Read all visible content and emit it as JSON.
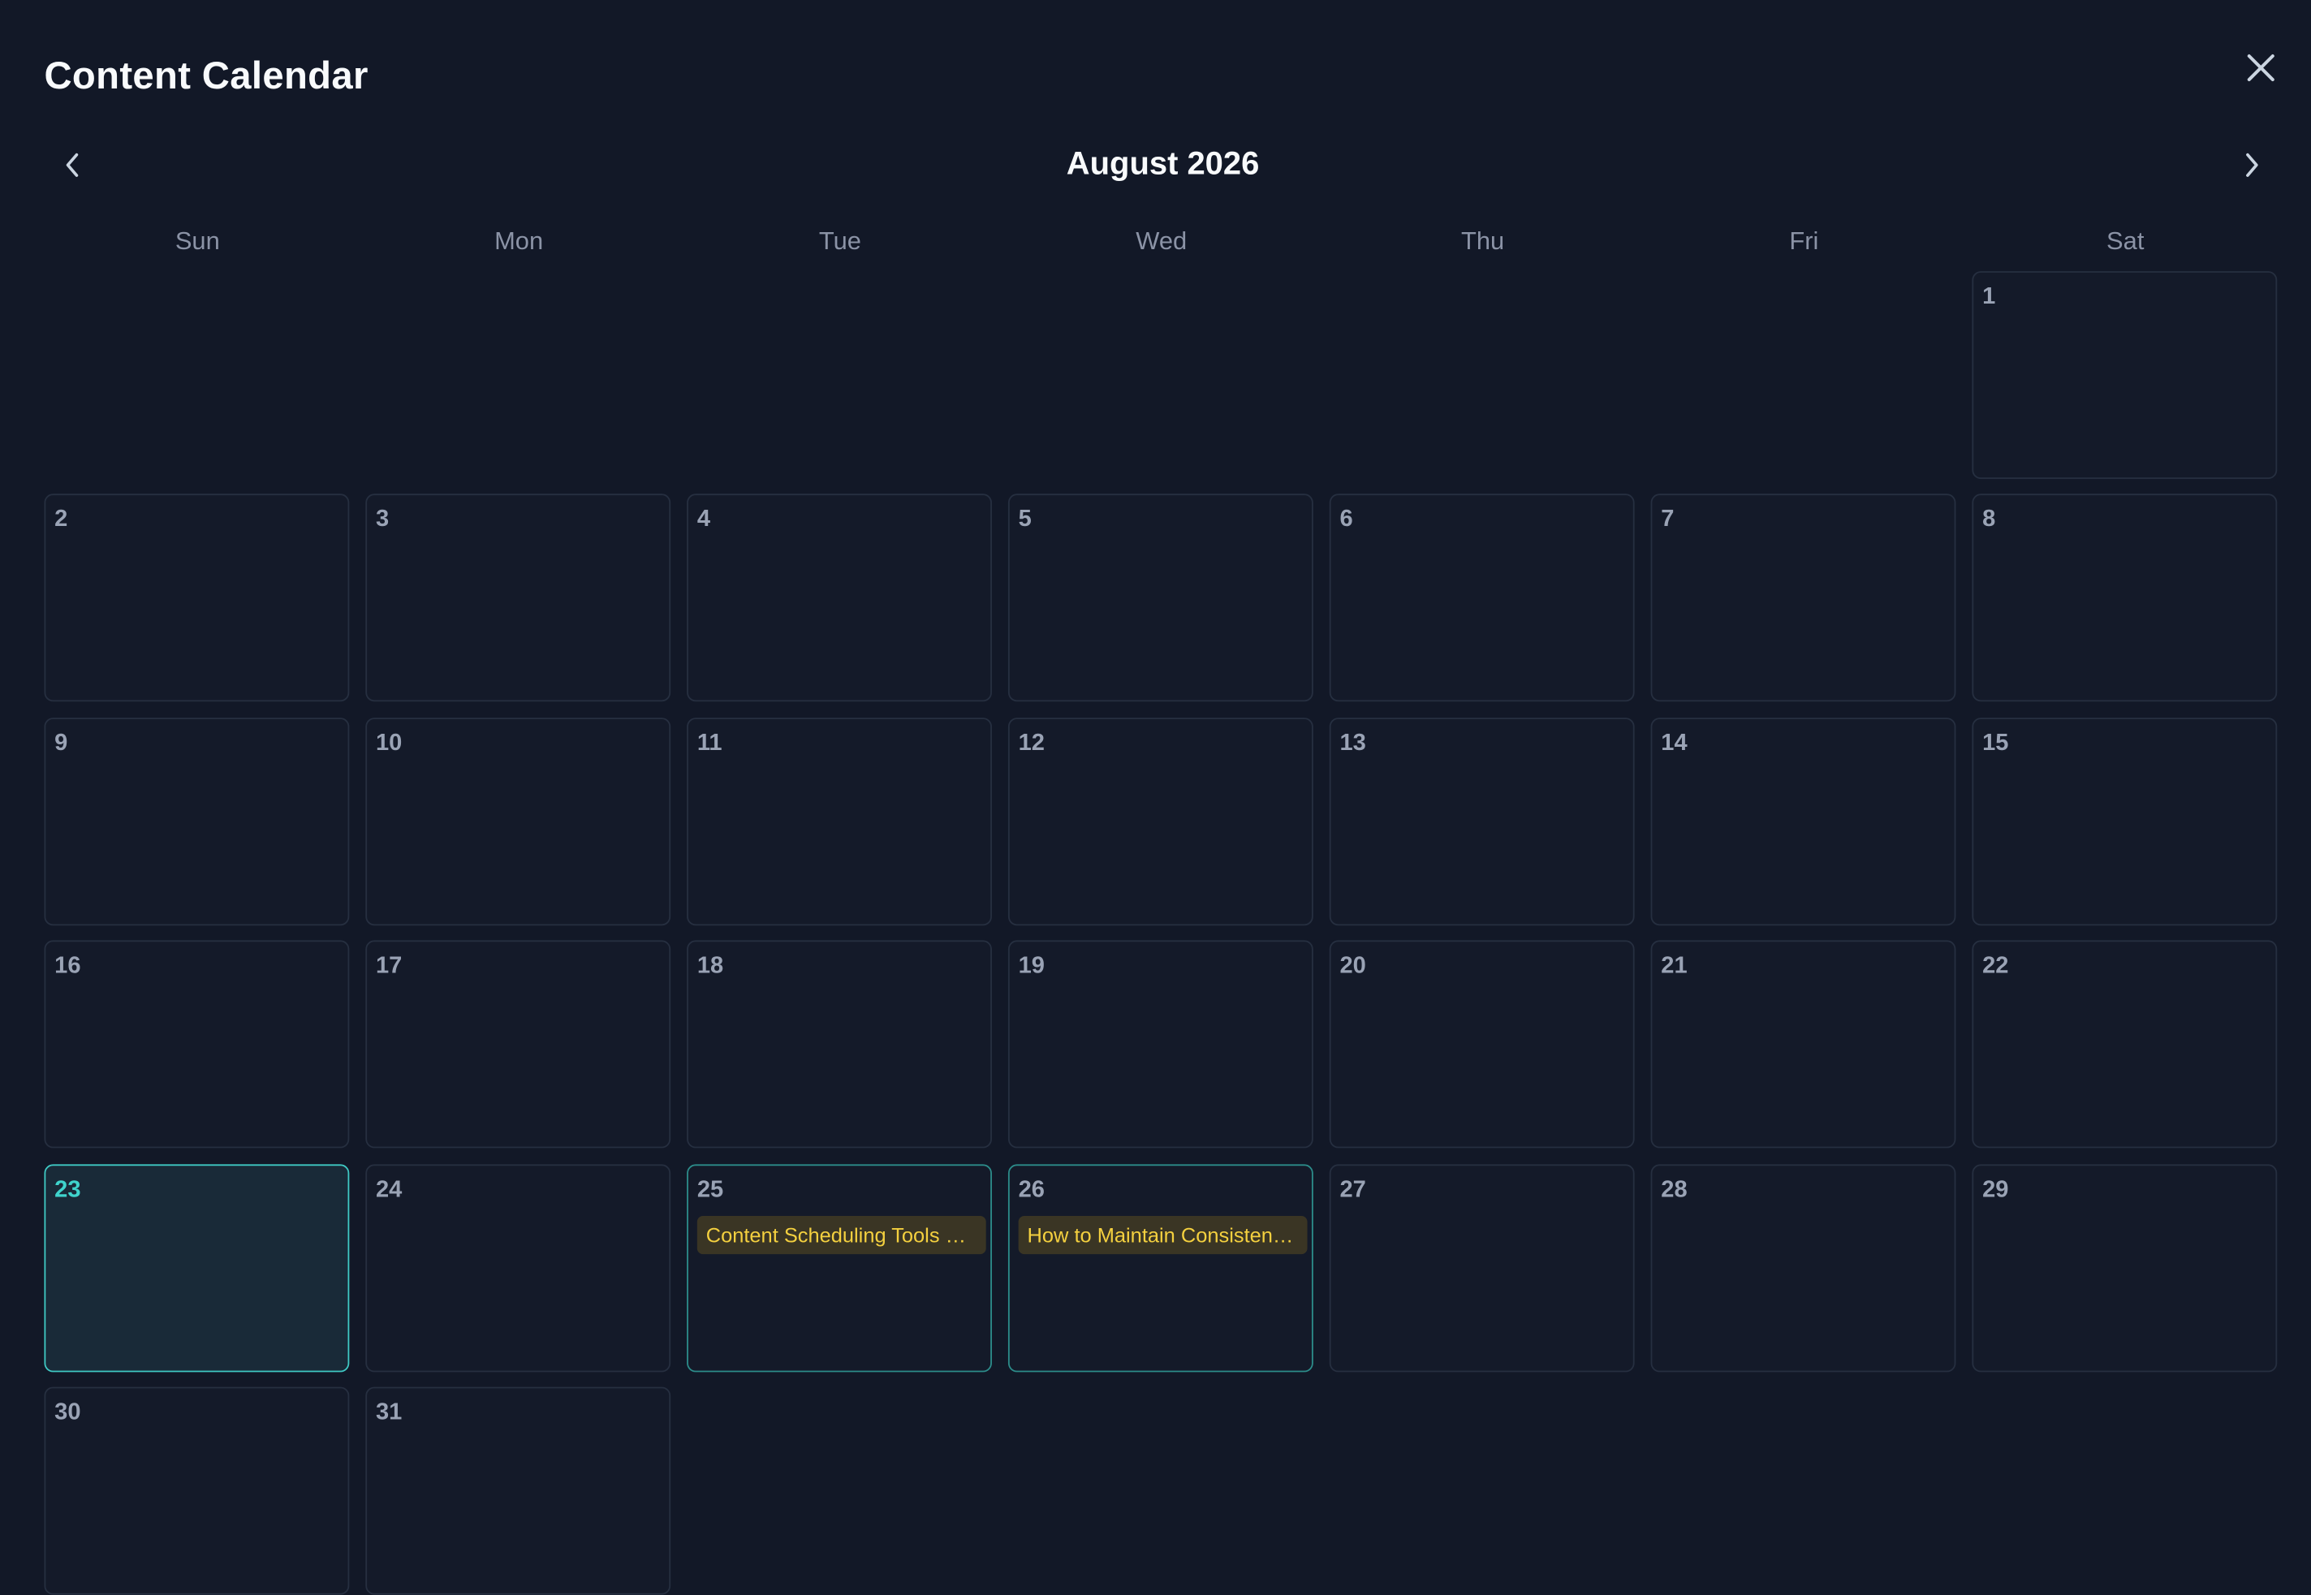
{
  "dialog": {
    "title": "Content Calendar",
    "close_icon": "close-icon"
  },
  "navigation": {
    "month_label": "August 2026",
    "prev_icon": "chevron-left-icon",
    "next_icon": "chevron-right-icon"
  },
  "weekdays": [
    "Sun",
    "Mon",
    "Tue",
    "Wed",
    "Thu",
    "Fri",
    "Sat"
  ],
  "days": [
    {
      "day": "1",
      "state": "normal",
      "events": []
    },
    {
      "day": "2",
      "state": "normal",
      "events": []
    },
    {
      "day": "3",
      "state": "normal",
      "events": []
    },
    {
      "day": "4",
      "state": "normal",
      "events": []
    },
    {
      "day": "5",
      "state": "normal",
      "events": []
    },
    {
      "day": "6",
      "state": "normal",
      "events": []
    },
    {
      "day": "7",
      "state": "normal",
      "events": []
    },
    {
      "day": "8",
      "state": "normal",
      "events": []
    },
    {
      "day": "9",
      "state": "normal",
      "events": []
    },
    {
      "day": "10",
      "state": "normal",
      "events": []
    },
    {
      "day": "11",
      "state": "normal",
      "events": []
    },
    {
      "day": "12",
      "state": "normal",
      "events": []
    },
    {
      "day": "13",
      "state": "normal",
      "events": []
    },
    {
      "day": "14",
      "state": "normal",
      "events": []
    },
    {
      "day": "15",
      "state": "normal",
      "events": []
    },
    {
      "day": "16",
      "state": "normal",
      "events": []
    },
    {
      "day": "17",
      "state": "normal",
      "events": []
    },
    {
      "day": "18",
      "state": "normal",
      "events": []
    },
    {
      "day": "19",
      "state": "normal",
      "events": []
    },
    {
      "day": "20",
      "state": "normal",
      "events": []
    },
    {
      "day": "21",
      "state": "normal",
      "events": []
    },
    {
      "day": "22",
      "state": "normal",
      "events": []
    },
    {
      "day": "23",
      "state": "today",
      "events": []
    },
    {
      "day": "24",
      "state": "normal",
      "events": []
    },
    {
      "day": "25",
      "state": "has-event",
      "events": [
        "Content Scheduling Tools an..."
      ]
    },
    {
      "day": "26",
      "state": "has-event",
      "events": [
        "How to Maintain Consistent ..."
      ]
    },
    {
      "day": "27",
      "state": "normal",
      "events": []
    },
    {
      "day": "28",
      "state": "normal",
      "events": []
    },
    {
      "day": "29",
      "state": "normal",
      "events": []
    },
    {
      "day": "30",
      "state": "normal",
      "events": []
    },
    {
      "day": "31",
      "state": "normal",
      "events": []
    }
  ],
  "colors": {
    "background": "#121827",
    "today_accent": "#3fc9c4",
    "event_border": "#2c8c8a",
    "event_text": "#f4d03f",
    "event_bg": "#3a3524"
  }
}
